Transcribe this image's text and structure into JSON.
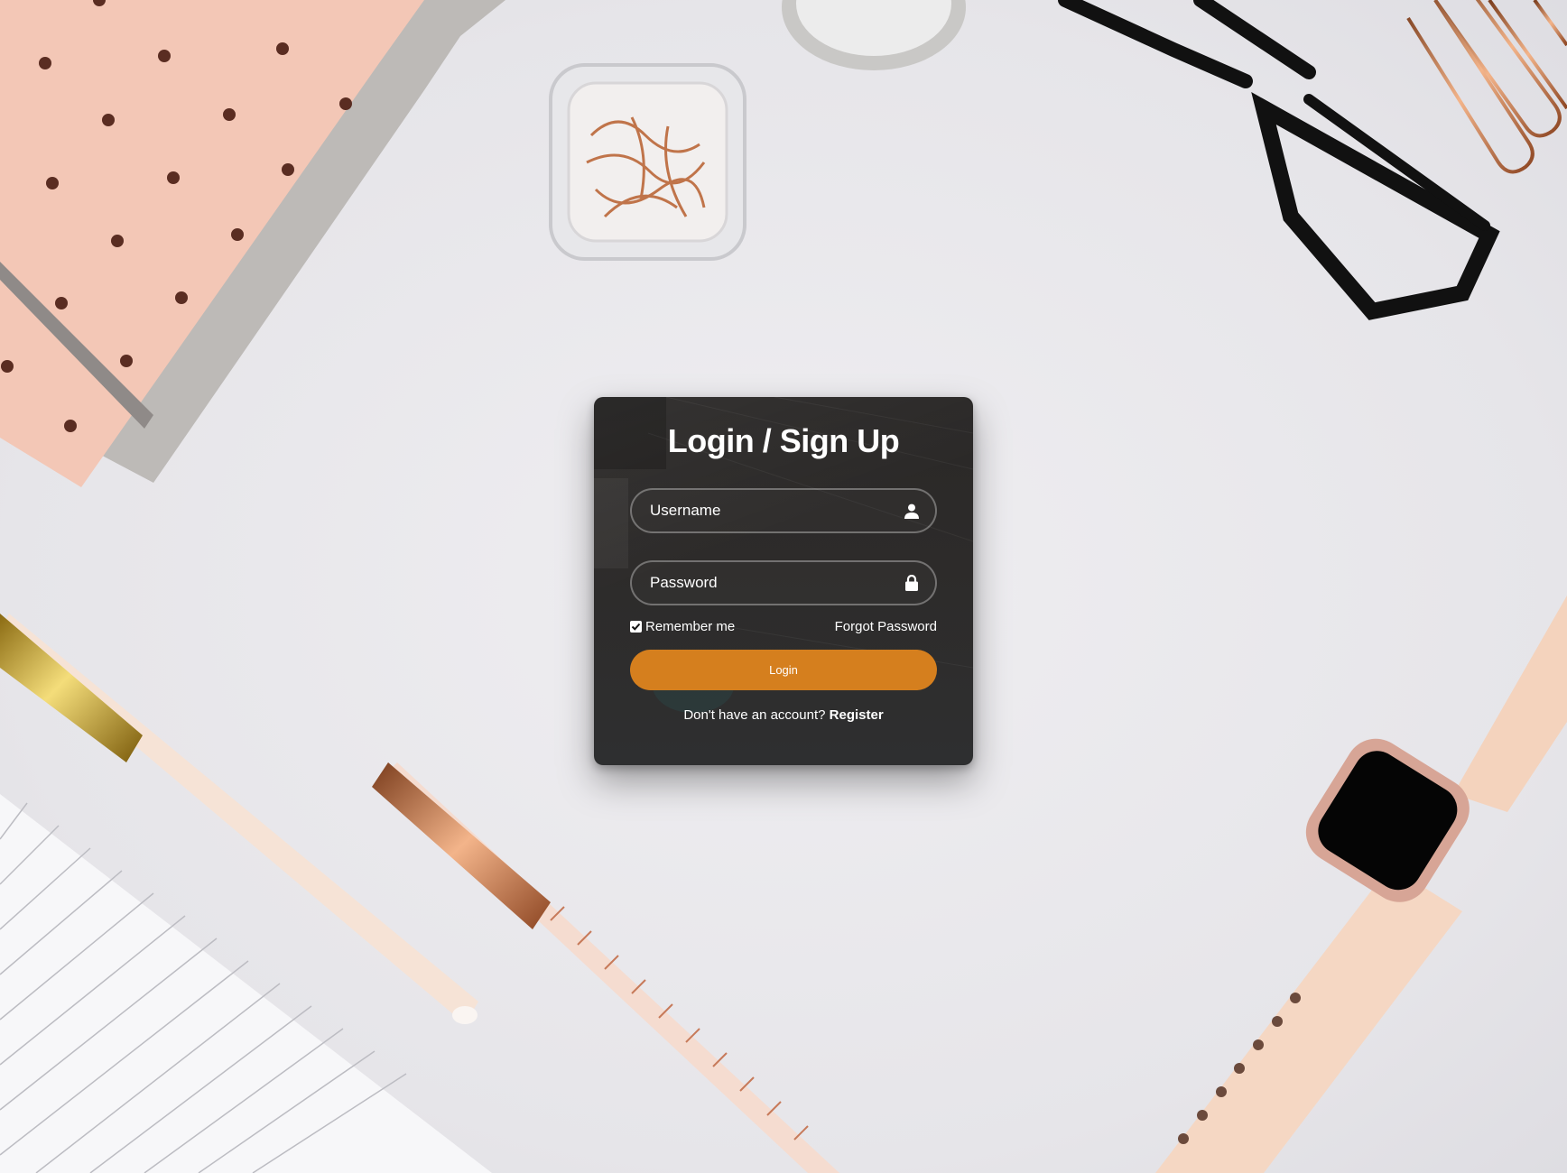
{
  "form": {
    "title": "Login / Sign Up",
    "username_placeholder": "Username",
    "password_placeholder": "Password",
    "username_icon": "user-icon",
    "password_icon": "lock-icon",
    "remember_label": "Remember me",
    "remember_checked": true,
    "forgot_label": "Forgot Password",
    "login_label": "Login",
    "register_prompt": "Don't have an account?",
    "register_link": "Register"
  },
  "colors": {
    "accent": "#d57f1e",
    "card_bg": "#2c2a29",
    "text": "#ffffff",
    "background": "#e9e8ec"
  }
}
